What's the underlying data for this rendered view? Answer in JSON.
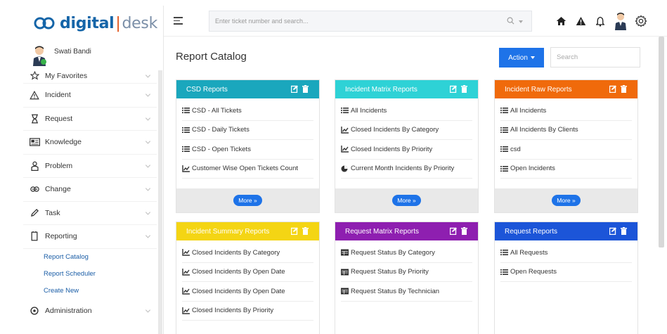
{
  "app": {
    "logo_digital": "digital",
    "logo_sep": "|",
    "logo_desk": "desk"
  },
  "user": {
    "name": "Swati Bandi"
  },
  "sidebar": {
    "items": [
      {
        "label": "My Favorites",
        "icon": "star-icon"
      },
      {
        "label": "Incident",
        "icon": "warning-icon"
      },
      {
        "label": "Request",
        "icon": "request-icon"
      },
      {
        "label": "Knowledge",
        "icon": "knowledge-icon"
      },
      {
        "label": "Problem",
        "icon": "problem-icon"
      },
      {
        "label": "Change",
        "icon": "change-icon"
      },
      {
        "label": "Task",
        "icon": "task-icon"
      },
      {
        "label": "Reporting",
        "icon": "reporting-icon"
      }
    ],
    "reporting_sub": [
      {
        "label": "Report Catalog"
      },
      {
        "label": "Report Scheduler"
      },
      {
        "label": "Create New"
      }
    ],
    "admin": {
      "label": "Administration",
      "icon": "admin-icon"
    }
  },
  "header": {
    "search_placeholder": "Enter ticket number and search..."
  },
  "page": {
    "title": "Report Catalog",
    "action_label": "Action",
    "search_placeholder": "Search",
    "more_label": "More »"
  },
  "colors": {
    "teal": "#1aa7bd",
    "cyan": "#2ed2d6",
    "orange": "#f06a0b",
    "yellow": "#f4d514",
    "purple": "#8e1fb0",
    "blue": "#1c55d8",
    "primary": "#1e73e8"
  },
  "cards": [
    {
      "title": "CSD Reports",
      "items": [
        {
          "label": "CSD - All Tickets",
          "icon": "list-icon"
        },
        {
          "label": "CSD - Daily Tickets",
          "icon": "list-icon"
        },
        {
          "label": "CSD - Open Tickets",
          "icon": "list-icon"
        },
        {
          "label": "Customer Wise Open Tickets Count",
          "icon": "chart-icon"
        }
      ]
    },
    {
      "title": "Incident Matrix Reports",
      "items": [
        {
          "label": "All Incidents",
          "icon": "list-icon"
        },
        {
          "label": "Closed Incidents By Category",
          "icon": "chart-icon"
        },
        {
          "label": "Closed Incidents By Priority",
          "icon": "chart-icon"
        },
        {
          "label": "Current Month Incidents By Priority",
          "icon": "pie-icon"
        }
      ]
    },
    {
      "title": "Incident Raw Reports",
      "items": [
        {
          "label": "All Incidents",
          "icon": "list-icon"
        },
        {
          "label": "All Incidents By Clients",
          "icon": "list-icon"
        },
        {
          "label": "csd",
          "icon": "list-icon"
        },
        {
          "label": "Open Incidents",
          "icon": "list-icon"
        }
      ]
    },
    {
      "title": "Incident Summary Reports",
      "items": [
        {
          "label": "Closed Incidents By Category",
          "icon": "chart-icon"
        },
        {
          "label": "Closed Incidents By Open Date",
          "icon": "chart-icon"
        },
        {
          "label": "Closed Incidents By Open Date",
          "icon": "chart-icon"
        },
        {
          "label": "Closed Incidents By Priority",
          "icon": "chart-icon"
        }
      ]
    },
    {
      "title": "Request Matrix Reports",
      "items": [
        {
          "label": "Request Status By Category",
          "icon": "table-icon"
        },
        {
          "label": "Request Status By Priority",
          "icon": "table-icon"
        },
        {
          "label": "Request Status By Technician",
          "icon": "table-icon"
        }
      ]
    },
    {
      "title": "Request Reports",
      "items": [
        {
          "label": "All Requests",
          "icon": "list-icon"
        },
        {
          "label": "Open Requests",
          "icon": "list-icon"
        }
      ]
    }
  ]
}
